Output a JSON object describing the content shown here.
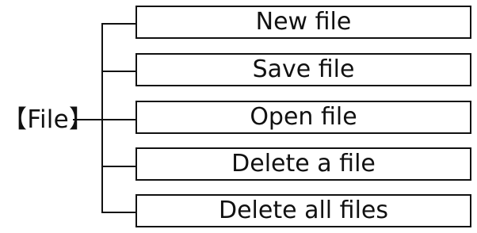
{
  "root": {
    "label": "【File】"
  },
  "menu": {
    "items": [
      {
        "label": "New file"
      },
      {
        "label": "Save file"
      },
      {
        "label": "Open file"
      },
      {
        "label": "Delete a file"
      },
      {
        "label": "Delete all files"
      }
    ]
  }
}
